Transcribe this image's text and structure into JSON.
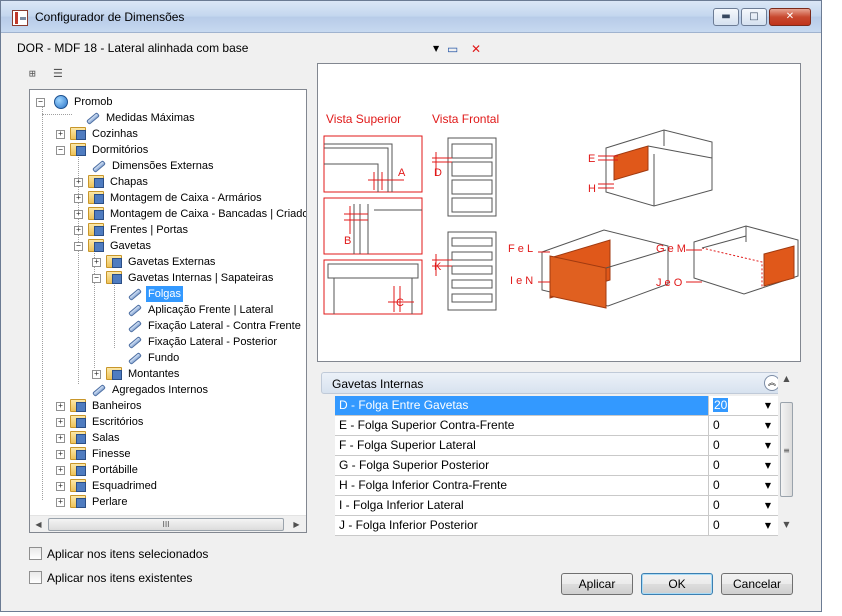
{
  "window": {
    "title": "Configurador de Dimensões",
    "controls": {
      "minimize": "▬",
      "maximize": "□",
      "close": "✕"
    }
  },
  "profile": {
    "selected": "DOR - MDF 18 - Lateral alinhada com base"
  },
  "tree": {
    "root": "Promob",
    "items": [
      "Medidas Máximas",
      "Cozinhas",
      "Dormitórios",
      "Dimensões Externas",
      "Chapas",
      "Montagem de Caixa - Armários",
      "Montagem de Caixa - Bancadas | Criados",
      "Frentes | Portas",
      "Gavetas",
      "Gavetas Externas",
      "Gavetas Internas | Sapateiras",
      "Folgas",
      "Aplicação Frente | Lateral",
      "Fixação Lateral - Contra Frente",
      "Fixação Lateral - Posterior",
      "Fundo",
      "Montantes",
      "Agregados Internos",
      "Banheiros",
      "Escritórios",
      "Salas",
      "Finesse",
      "Portábille",
      "Esquadrimed",
      "Perlare"
    ],
    "selected": "Folgas",
    "hscroll_thumb": "III"
  },
  "options": {
    "apply_selected": "Aplicar nos itens selecionados",
    "apply_existing": "Aplicar nos itens existentes"
  },
  "diagram": {
    "vista_superior": "Vista Superior",
    "vista_frontal": "Vista Frontal",
    "labels": {
      "A": "A",
      "B": "B",
      "C": "C",
      "D": "D",
      "K": "K",
      "E": "E",
      "H": "H",
      "FeL": "F e L",
      "IeN": "I e N",
      "GeM": "G e M",
      "JeO": "J e O"
    }
  },
  "properties": {
    "group": "Gavetas Internas",
    "rows": [
      {
        "name": "D - Folga Entre Gavetas",
        "value": "20"
      },
      {
        "name": "E - Folga Superior Contra-Frente",
        "value": "0"
      },
      {
        "name": "F - Folga Superior Lateral",
        "value": "0"
      },
      {
        "name": "G - Folga Superior Posterior",
        "value": "0"
      },
      {
        "name": "H - Folga Inferior Contra-Frente",
        "value": "0"
      },
      {
        "name": "I - Folga Inferior Lateral",
        "value": "0"
      },
      {
        "name": "J - Folga Inferior Posterior",
        "value": "0"
      }
    ],
    "selected_row": 0,
    "vscroll_thumb": "≡"
  },
  "buttons": {
    "apply": "Aplicar",
    "ok": "OK",
    "cancel": "Cancelar"
  },
  "colors": {
    "accent_red": "#e01919",
    "selection": "#3399ff",
    "drawer_orange": "#e0581a"
  }
}
